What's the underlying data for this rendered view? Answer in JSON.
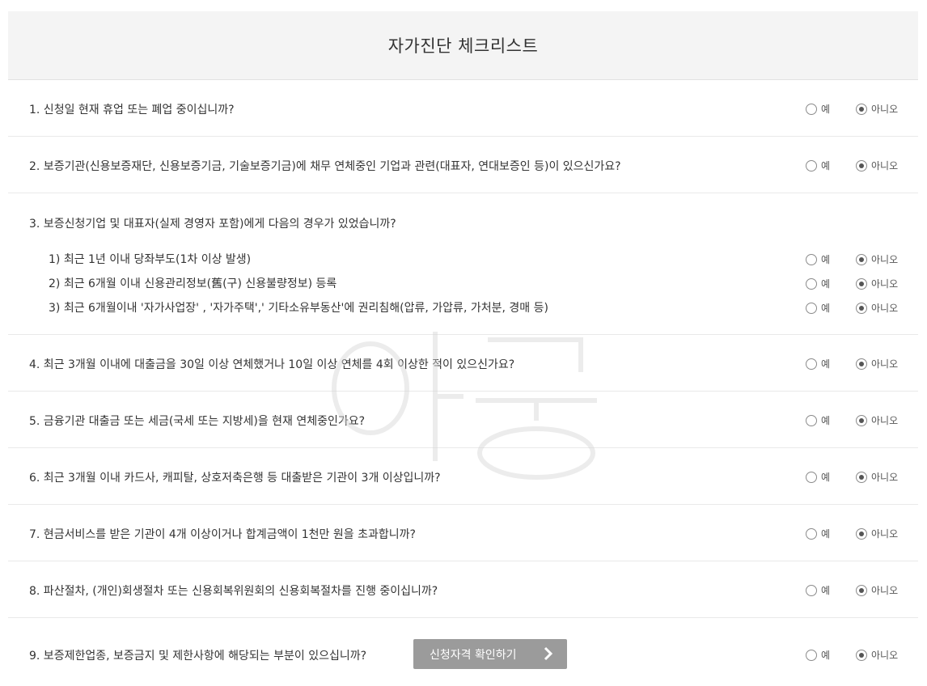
{
  "header": {
    "title": "자가진단 체크리스트"
  },
  "options": {
    "yes": "예",
    "no": "아니오"
  },
  "questions": [
    {
      "text": "1. 신청일 현재 휴업 또는 폐업 중이십니까?",
      "selected": "no"
    },
    {
      "text": "2. 보증기관(신용보증재단, 신용보증기금, 기술보증기금)에 채무 연체중인 기업과 관련(대표자, 연대보증인 등)이 있으신가요?",
      "selected": "no"
    },
    {
      "text": "3. 보증신청기업 및 대표자(실제 경영자 포함)에게 다음의 경우가 있었습니까?",
      "subs": [
        {
          "text": "1) 최근 1년 이내 당좌부도(1차 이상 발생)",
          "selected": "no"
        },
        {
          "text": "2) 최근 6개월 이내 신용관리정보(舊(구) 신용불량정보) 등록",
          "selected": "no"
        },
        {
          "text": "3) 최근 6개월이내 '자가사업장' , '자가주택',' 기타소유부동산'에 권리침해(압류, 가압류, 가처분, 경매 등)",
          "selected": "no"
        }
      ]
    },
    {
      "text": "4. 최근 3개월 이내에 대출금을 30일 이상 연체했거나 10일 이상 연체를 4회 이상한 적이 있으신가요?",
      "selected": "no"
    },
    {
      "text": "5. 금융기관 대출금 또는 세금(국세 또는 지방세)을 현재 연체중인가요?",
      "selected": "no"
    },
    {
      "text": "6. 최근 3개월 이내 카드사, 캐피탈, 상호저축은행 등 대출받은 기관이 3개 이상입니까?",
      "selected": "no"
    },
    {
      "text": "7. 현금서비스를 받은 기관이 4개 이상이거나 합계금액이 1천만 원을 초과합니까?",
      "selected": "no"
    },
    {
      "text": "8. 파산절차, (개인)회생절차 또는 신용회복위원회의 신용회복절차를 진행 중이십니까?",
      "selected": "no"
    },
    {
      "text": "9. 보증제한업종, 보증금지 및 제한사항에 해당되는 부분이 있으십니까?",
      "selected": "no",
      "button": "신청자격 확인하기"
    }
  ],
  "colors": {
    "header_bg": "#f4f4f4",
    "button_bg": "#9b9b9b",
    "radio_dot": "#555555"
  }
}
